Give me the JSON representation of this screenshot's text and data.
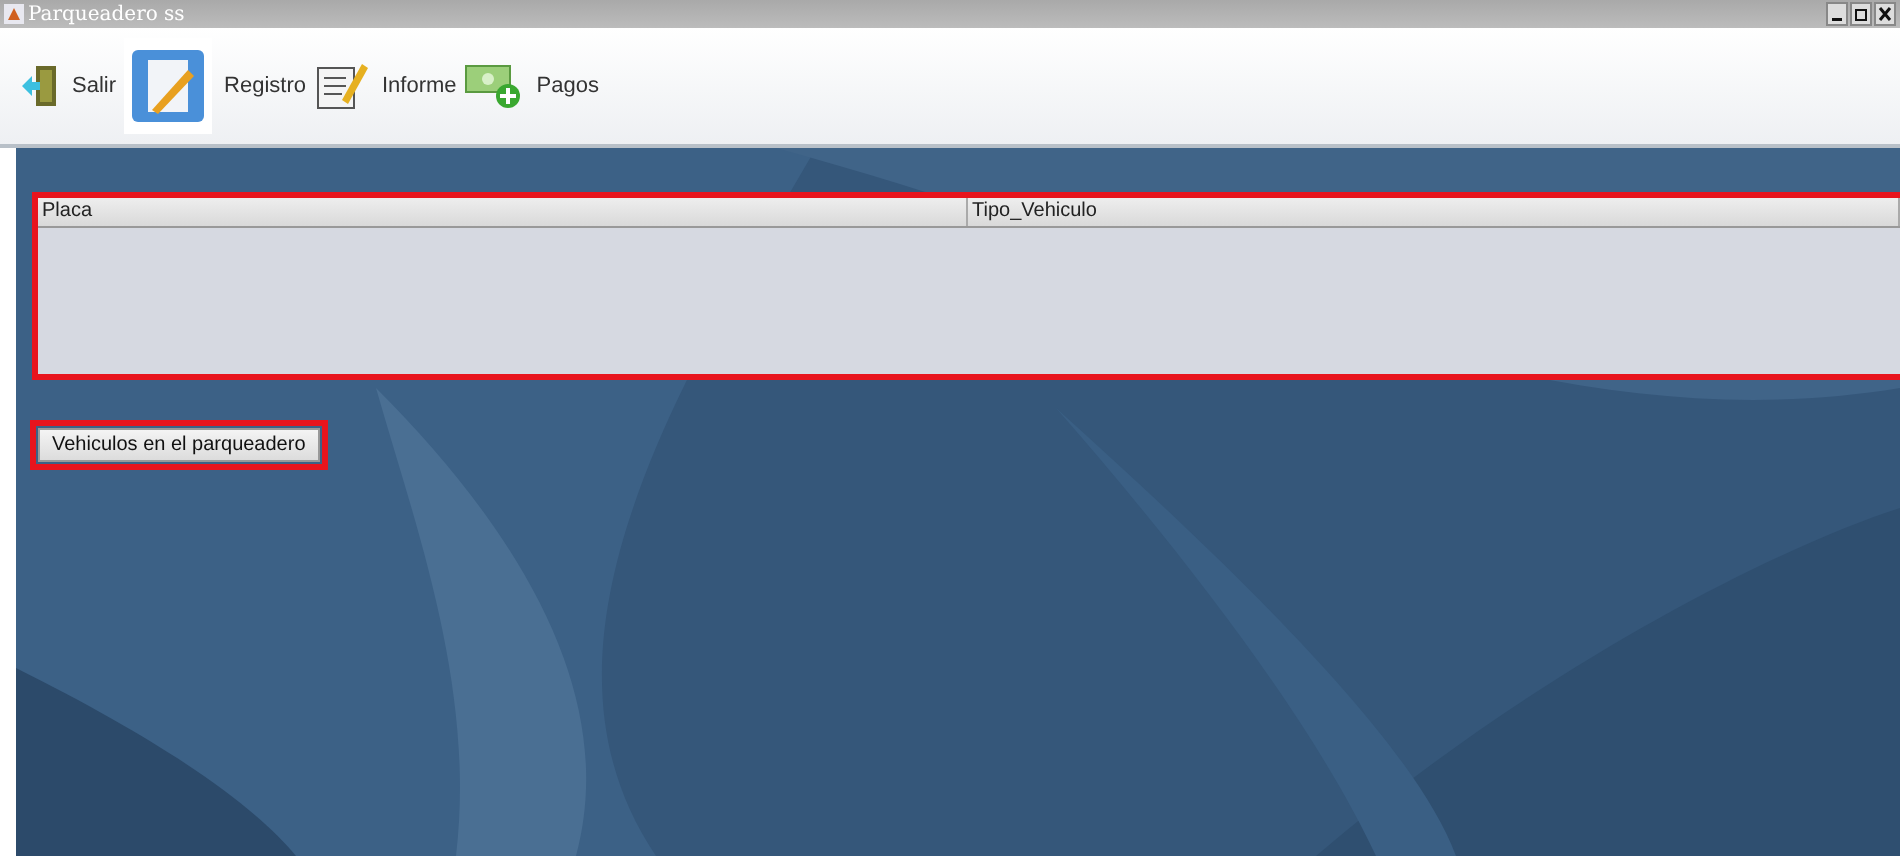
{
  "window": {
    "title": "Parqueadero ss"
  },
  "toolbar": [
    {
      "label": "Salir",
      "kind": "exit",
      "selected": false
    },
    {
      "label": "Registro",
      "kind": "register",
      "selected": true
    },
    {
      "label": "Informe",
      "kind": "report",
      "selected": false
    },
    {
      "label": "Pagos",
      "kind": "payments",
      "selected": false
    }
  ],
  "table": {
    "columns": [
      "Placa",
      "Tipo_Vehiculo"
    ]
  },
  "button": "Vehiculos en el parqueadero"
}
